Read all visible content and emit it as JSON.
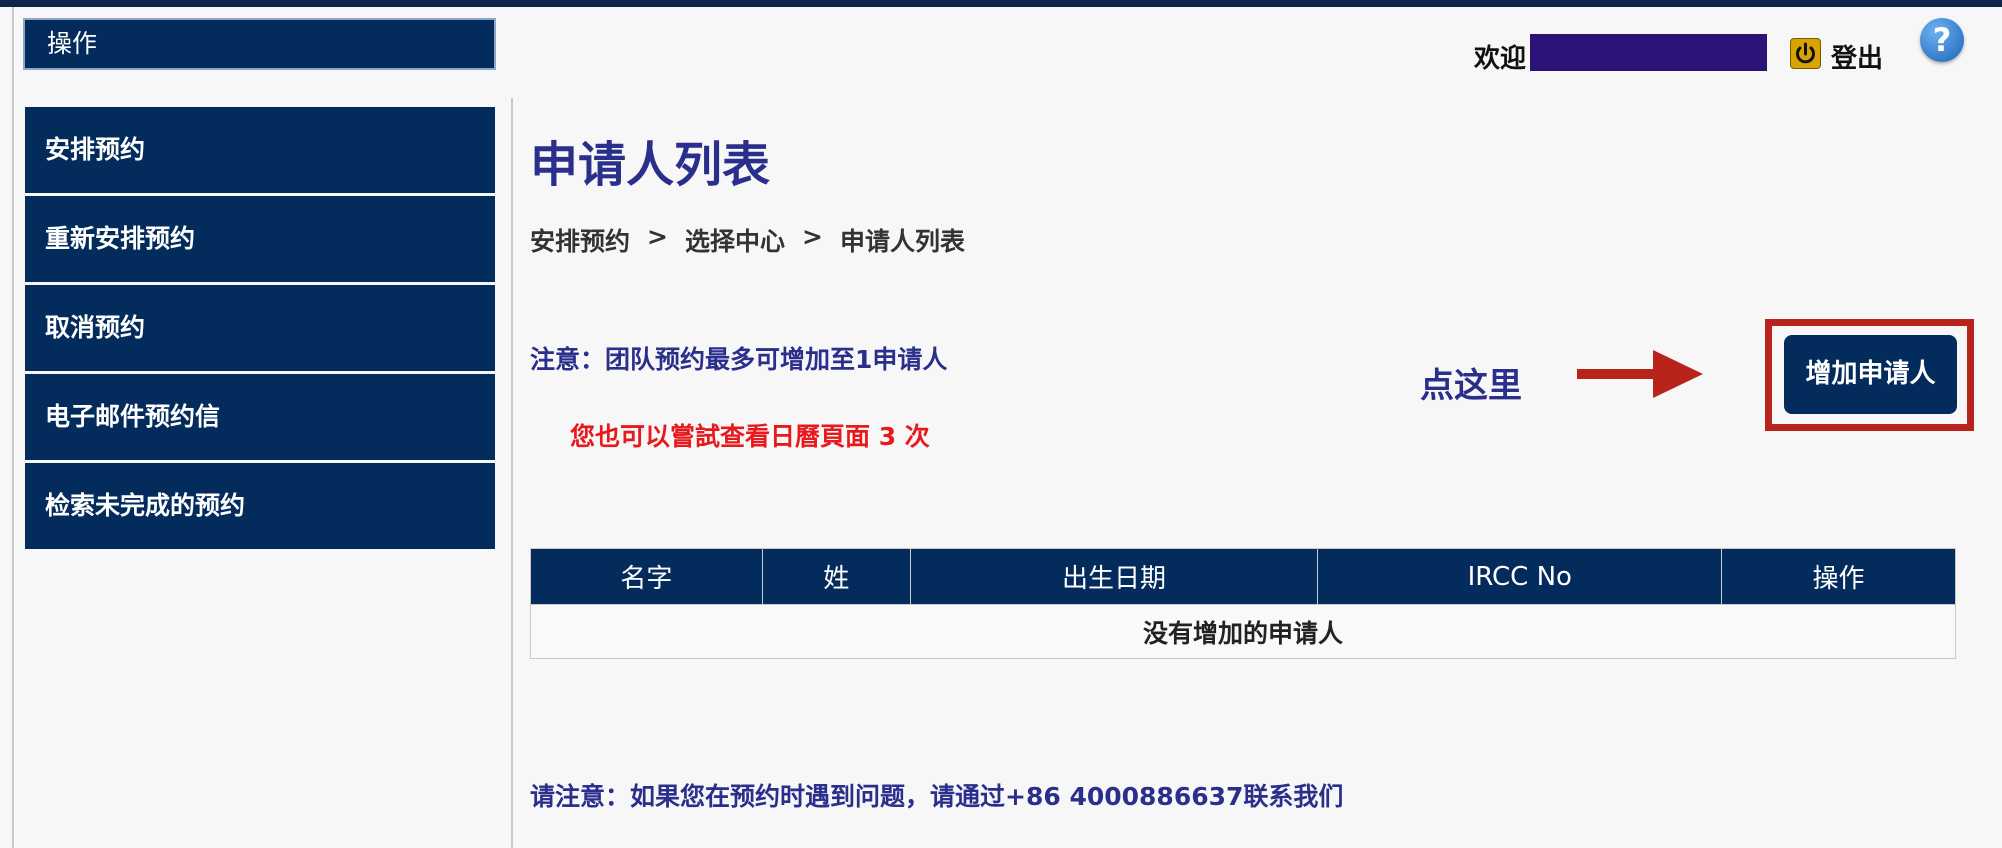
{
  "sidebar": {
    "header": "操作",
    "items": [
      {
        "label": "安排预约"
      },
      {
        "label": "重新安排预约"
      },
      {
        "label": "取消预约"
      },
      {
        "label": "电子邮件预约信"
      },
      {
        "label": "检索未完成的预约"
      }
    ]
  },
  "header": {
    "welcome": "欢迎",
    "logout": "登出",
    "help": "?"
  },
  "main": {
    "title": "申请人列表",
    "breadcrumb": [
      "安排预约",
      "选择中心",
      "申请人列表"
    ],
    "breadcrumb_sep": ">",
    "notice": "注意：团队预约最多可增加至1申请人",
    "red_note": "您也可以嘗試查看日曆頁面 3 次",
    "annotation": "点这里",
    "add_button": "增加申请人",
    "table": {
      "headers": [
        "名字",
        "姓",
        "出生日期",
        "IRCC No",
        "操作"
      ],
      "empty": "没有增加的申请人"
    },
    "footer": "请注意：如果您在预约时遇到问题，请通过+86 4000886637联系我们"
  },
  "colors": {
    "navy": "#032c5c",
    "title_blue": "#2b2f8c",
    "red": "#e8191c",
    "annotation_red": "#b8231b"
  },
  "icons": {
    "logout": "power-icon",
    "help": "help-icon",
    "annotation": "arrow-right-icon"
  }
}
